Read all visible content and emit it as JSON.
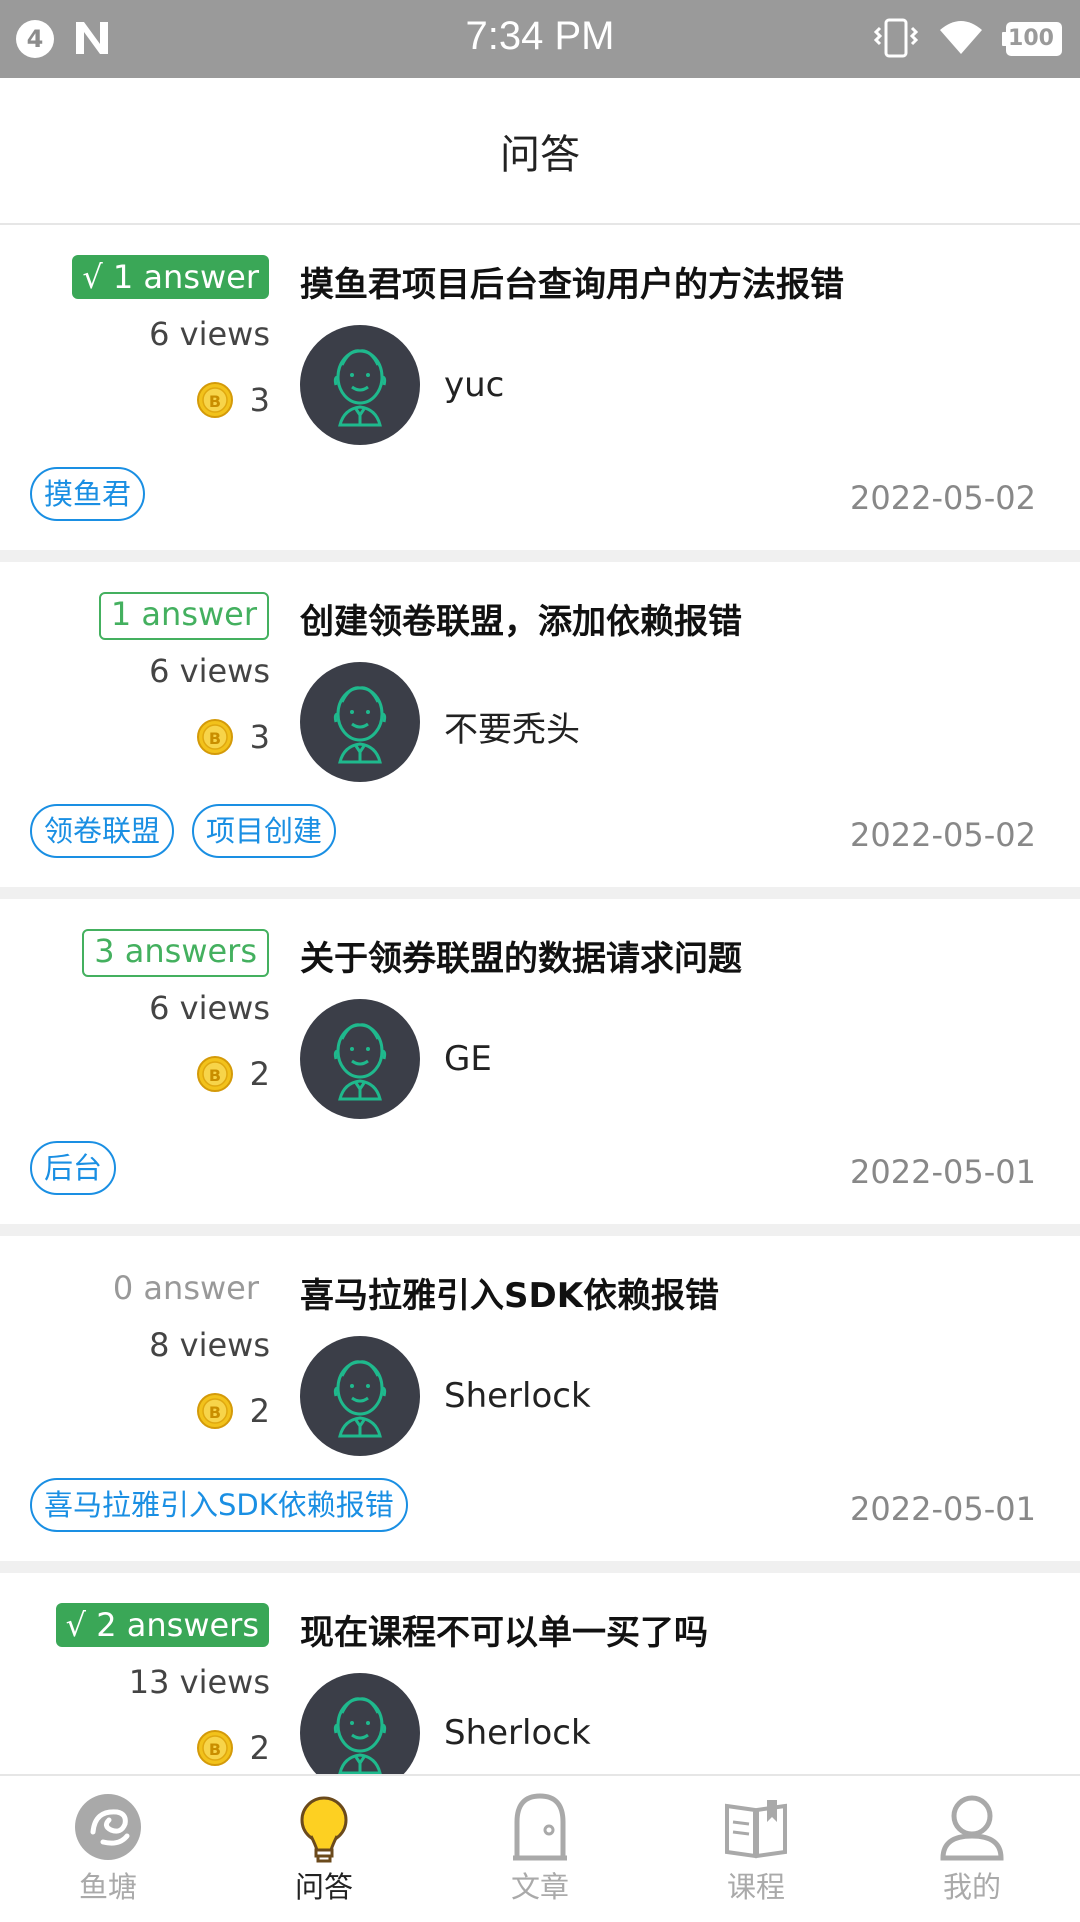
{
  "status_bar": {
    "notification_count": "4",
    "time": "7:34 PM",
    "battery": "100"
  },
  "header": {
    "title": "问答"
  },
  "questions": [
    {
      "answers": "√ 1 answer",
      "answer_style": "accepted",
      "views": "6 views",
      "reward": "3",
      "title": "摸鱼君项目后台查询用户的方法报错",
      "author": "yuc",
      "tags": [
        "摸鱼君"
      ],
      "date": "2022-05-02"
    },
    {
      "answers": "1 answer",
      "answer_style": "outlined",
      "views": "6 views",
      "reward": "3",
      "title": "创建领卷联盟，添加依赖报错",
      "author": "不要秃头",
      "tags": [
        "领卷联盟",
        "项目创建"
      ],
      "date": "2022-05-02"
    },
    {
      "answers": "3 answers",
      "answer_style": "outlined",
      "views": "6 views",
      "reward": "2",
      "title": "关于领券联盟的数据请求问题",
      "author": "GE",
      "tags": [
        "后台"
      ],
      "date": "2022-05-01"
    },
    {
      "answers": "0 answer",
      "answer_style": "plain",
      "views": "8 views",
      "reward": "2",
      "title": "喜马拉雅引入SDK依赖报错",
      "author": "Sherlock",
      "tags": [
        "喜马拉雅引入SDK依赖报错"
      ],
      "date": "2022-05-01"
    },
    {
      "answers": "√ 2 answers",
      "answer_style": "accepted",
      "views": "13 views",
      "reward": "2",
      "title": "现在课程不可以单一买了吗",
      "author": "Sherlock",
      "tags": [],
      "date": ""
    }
  ],
  "nav": {
    "items": [
      {
        "label": "鱼塘",
        "icon": "fish-pond-icon"
      },
      {
        "label": "问答",
        "icon": "lightbulb-icon",
        "active": true
      },
      {
        "label": "文章",
        "icon": "article-door-icon"
      },
      {
        "label": "课程",
        "icon": "book-icon"
      },
      {
        "label": "我的",
        "icon": "user-icon"
      }
    ]
  },
  "colors": {
    "accepted": "#3aa757",
    "tag": "#1a8fe3",
    "avatar_bg": "#3b3e48",
    "avatar_line": "#1fb98d"
  }
}
